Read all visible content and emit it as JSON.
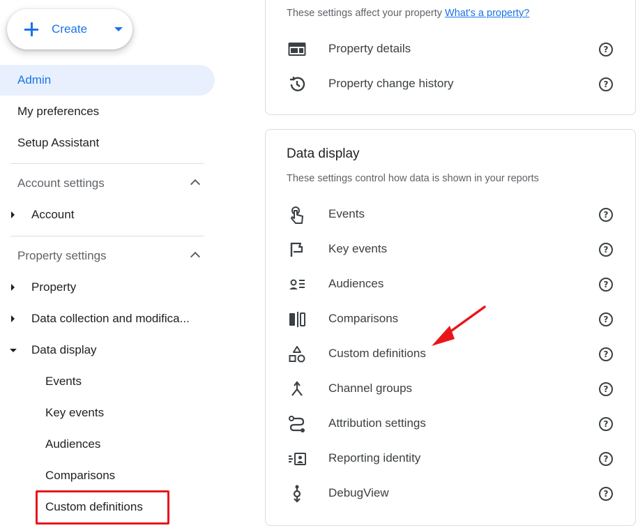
{
  "create": {
    "label": "Create"
  },
  "nav": {
    "admin": "Admin",
    "preferences": "My preferences",
    "setup": "Setup Assistant",
    "account_settings": "Account settings",
    "account": "Account",
    "property_settings": "Property settings",
    "property": "Property",
    "data_collection": "Data collection and modifica...",
    "data_display": "Data display",
    "sub_items": [
      "Events",
      "Key events",
      "Audiences",
      "Comparisons",
      "Custom definitions"
    ]
  },
  "property_card": {
    "note": "These settings affect your property",
    "link": "What's a property?",
    "rows": [
      {
        "label": "Property details",
        "icon": "property-details-icon"
      },
      {
        "label": "Property change history",
        "icon": "history-icon"
      }
    ]
  },
  "display_card": {
    "title": "Data display",
    "note": "These settings control how data is shown in your reports",
    "rows": [
      {
        "label": "Events",
        "icon": "touch-icon"
      },
      {
        "label": "Key events",
        "icon": "flag-icon"
      },
      {
        "label": "Audiences",
        "icon": "audience-icon"
      },
      {
        "label": "Comparisons",
        "icon": "comparison-icon"
      },
      {
        "label": "Custom definitions",
        "icon": "shapes-icon"
      },
      {
        "label": "Channel groups",
        "icon": "merge-icon"
      },
      {
        "label": "Attribution settings",
        "icon": "route-icon"
      },
      {
        "label": "Reporting identity",
        "icon": "identity-icon"
      },
      {
        "label": "DebugView",
        "icon": "debug-icon"
      }
    ]
  },
  "colors": {
    "accent": "#1a73e8",
    "active_bg": "#e8f0fe",
    "highlight": "#e8161b"
  }
}
